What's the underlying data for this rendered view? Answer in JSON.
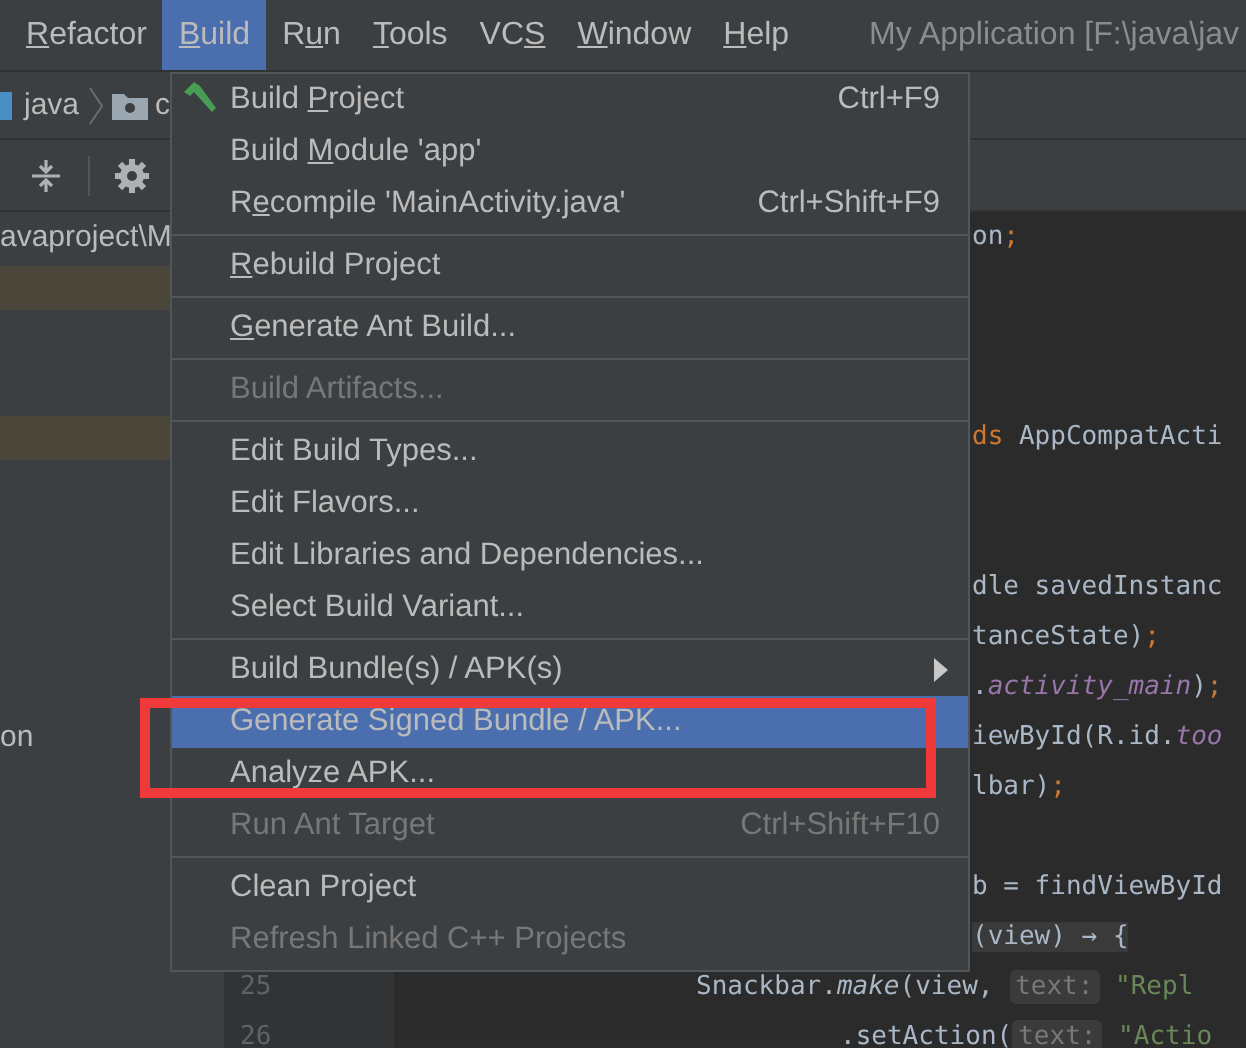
{
  "menubar": {
    "items": [
      {
        "label": {
          "key": "R",
          "after": "efactor"
        },
        "selected": false
      },
      {
        "label": {
          "key": "B",
          "after": "uild"
        },
        "selected": true
      },
      {
        "label": {
          "before": "R",
          "key": "u",
          "after": "n"
        },
        "selected": false
      },
      {
        "label": {
          "key": "T",
          "after": "ools"
        },
        "selected": false
      },
      {
        "label": {
          "before": "VC",
          "key": "S"
        },
        "selected": false
      },
      {
        "label": {
          "key": "W",
          "after": "indow"
        },
        "selected": false
      },
      {
        "label": {
          "key": "H",
          "after": "elp"
        },
        "selected": false
      }
    ],
    "title": "My Application [F:\\java\\jav"
  },
  "navbar": {
    "crumbs": [
      "java",
      "c"
    ]
  },
  "project_panel": {
    "rows": [
      {
        "kind": "text",
        "label": "avaproject\\M"
      },
      {
        "kind": "highlight"
      },
      {
        "kind": "blank"
      },
      {
        "kind": "blank"
      },
      {
        "kind": "highlight"
      },
      {
        "kind": "blank"
      },
      {
        "kind": "blank"
      },
      {
        "kind": "blank"
      },
      {
        "kind": "blank"
      },
      {
        "kind": "blank"
      },
      {
        "kind": "text",
        "label": "on"
      }
    ]
  },
  "editor": {
    "lines": [
      {
        "kind": "tail",
        "segments": [
          {
            "t": "on",
            "kind": "plain"
          },
          {
            "t": ";",
            "kind": "keyword"
          }
        ]
      },
      {
        "kind": "blank"
      },
      {
        "kind": "blank"
      },
      {
        "kind": "blank"
      },
      {
        "kind": "tail",
        "segments": [
          {
            "t": "ds",
            "kind": "keyword"
          },
          {
            "t": " AppCompatActi",
            "kind": "plain"
          }
        ]
      },
      {
        "kind": "blank"
      },
      {
        "kind": "blank"
      },
      {
        "kind": "tail",
        "segments": [
          {
            "t": "dle savedInstanc",
            "kind": "plain"
          }
        ]
      },
      {
        "kind": "tail",
        "segments": [
          {
            "t": "tanceState)",
            "kind": "plain"
          },
          {
            "t": ";",
            "kind": "keyword"
          }
        ]
      },
      {
        "kind": "tail",
        "segments": [
          {
            "t": ".",
            "kind": "plain"
          },
          {
            "t": "activity_main",
            "kind": "field"
          },
          {
            "t": ")",
            "kind": "plain"
          },
          {
            "t": ";",
            "kind": "keyword"
          }
        ]
      },
      {
        "kind": "tail",
        "segments": [
          {
            "t": "iewById(R.id.",
            "kind": "plain"
          },
          {
            "t": "too",
            "kind": "field"
          }
        ]
      },
      {
        "kind": "tail",
        "segments": [
          {
            "t": "lbar)",
            "kind": "plain"
          },
          {
            "t": ";",
            "kind": "keyword"
          }
        ]
      },
      {
        "kind": "blank"
      },
      {
        "kind": "tail",
        "segments": [
          {
            "t": "b = findViewById",
            "kind": "plain"
          }
        ]
      },
      {
        "kind": "fold",
        "segments": [
          {
            "t": "(view) → {",
            "kind": "plain"
          }
        ]
      },
      {
        "kind": "numbered",
        "number": "25",
        "segments": [
          {
            "t": "Snackbar.",
            "kind": "plain"
          },
          {
            "t": "make",
            "kind": "method"
          },
          {
            "t": "(view, ",
            "kind": "plain"
          },
          {
            "t": "text:",
            "kind": "hint"
          },
          {
            "t": " \"Repl",
            "kind": "string"
          }
        ]
      },
      {
        "kind": "numbered",
        "number": "26",
        "segments": [
          {
            "t": ".setAction(",
            "kind": "plain"
          },
          {
            "t": "text:",
            "kind": "hint"
          },
          {
            "t": " \"Actio",
            "kind": "string"
          }
        ]
      }
    ]
  },
  "build_menu": {
    "items": [
      {
        "kind": "icon_item",
        "label": {
          "before": "Build ",
          "key": "P",
          "after": "roject"
        },
        "shortcut": "Ctrl+F9",
        "disabled": false,
        "selected": false
      },
      {
        "kind": "item",
        "label": {
          "before": "Build ",
          "key": "M",
          "after": "odule 'app'"
        },
        "disabled": false,
        "selected": false
      },
      {
        "kind": "item",
        "label": {
          "before": "R",
          "key": "e",
          "after": "compile 'MainActivity.java'"
        },
        "shortcut": "Ctrl+Shift+F9",
        "disabled": false,
        "selected": false
      },
      {
        "kind": "separator"
      },
      {
        "kind": "item",
        "label": {
          "key": "R",
          "after": "ebuild Project"
        },
        "disabled": false,
        "selected": false
      },
      {
        "kind": "separator"
      },
      {
        "kind": "item",
        "label": {
          "key": "G",
          "after": "enerate Ant Build..."
        },
        "disabled": false,
        "selected": false
      },
      {
        "kind": "separator"
      },
      {
        "kind": "item",
        "label": {
          "before": "Build Artifacts..."
        },
        "disabled": true,
        "selected": false
      },
      {
        "kind": "separator"
      },
      {
        "kind": "item",
        "label": {
          "before": "Edit Build Types..."
        },
        "disabled": false,
        "selected": false
      },
      {
        "kind": "item",
        "label": {
          "before": "Edit Flavors..."
        },
        "disabled": false,
        "selected": false
      },
      {
        "kind": "item",
        "label": {
          "before": "Edit Libraries and Dependencies..."
        },
        "disabled": false,
        "selected": false
      },
      {
        "kind": "item",
        "label": {
          "before": "Select Build Variant..."
        },
        "disabled": false,
        "selected": false
      },
      {
        "kind": "separator"
      },
      {
        "kind": "submenu_item",
        "label": {
          "before": "Build Bundle(s) / APK(s)"
        },
        "disabled": false,
        "selected": false
      },
      {
        "kind": "item",
        "label": {
          "before": "Generate Signed Bundle / APK..."
        },
        "disabled": false,
        "selected": true
      },
      {
        "kind": "item",
        "label": {
          "before": "Analyze APK..."
        },
        "disabled": false,
        "selected": false
      },
      {
        "kind": "item",
        "label": {
          "before": "Run Ant Target"
        },
        "shortcut": "Ctrl+Shift+F10",
        "disabled": true,
        "selected": false
      },
      {
        "kind": "separator"
      },
      {
        "kind": "item",
        "label": {
          "before": "Clean Project"
        },
        "disabled": false,
        "selected": false
      },
      {
        "kind": "item",
        "label": {
          "before": "Refresh Linked C++ Projects"
        },
        "disabled": true,
        "selected": false
      }
    ]
  },
  "annotation": {
    "kind": "frame"
  }
}
